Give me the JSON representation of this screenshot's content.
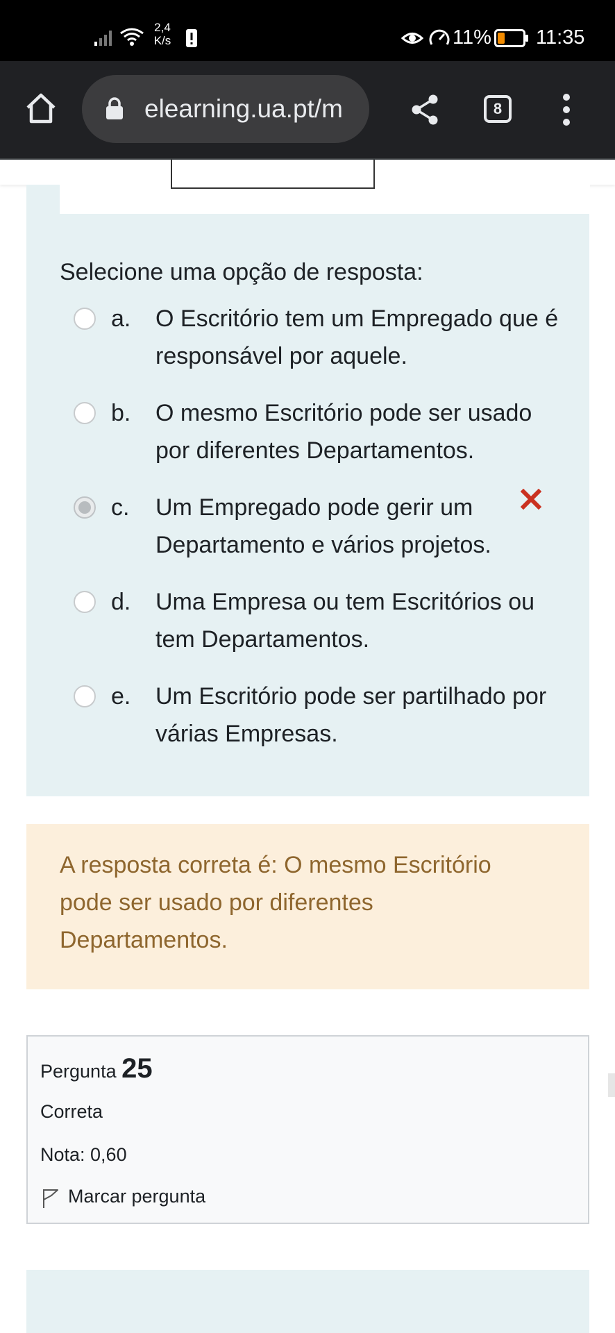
{
  "status_bar": {
    "net_speed_value": "2,4",
    "net_speed_unit": "K/s",
    "battery_percent": "11%",
    "time": "11:35",
    "battery_color": "#f28b00"
  },
  "browser": {
    "url": "elearning.ua.pt/m",
    "tab_count": "8"
  },
  "question": {
    "prompt": "Selecione uma opção de resposta:",
    "options": [
      {
        "letter": "a.",
        "text": "O Escritório tem um Empregado que é responsável por aquele.",
        "selected": false
      },
      {
        "letter": "b.",
        "text": "O mesmo Escritório pode ser usado por diferentes Departamentos.",
        "selected": false
      },
      {
        "letter": "c.",
        "text": "Um Empregado pode gerir um Departamento e vários projetos.",
        "selected": true
      },
      {
        "letter": "d.",
        "text": "Uma Empresa ou tem Escritórios ou tem Departamentos.",
        "selected": false
      },
      {
        "letter": "e.",
        "text": "Um Escritório pode ser partilhado por várias Empresas.",
        "selected": false
      }
    ],
    "wrong_mark_color": "#ca3120"
  },
  "feedback": {
    "text": "A resposta correta é: O mesmo Escritório pode ser usado por diferentes Departamentos."
  },
  "next_question_info": {
    "label": "Pergunta",
    "number": "25",
    "state": "Correta",
    "grade": "Nota: 0,60",
    "flag_label": "Marcar pergunta"
  }
}
